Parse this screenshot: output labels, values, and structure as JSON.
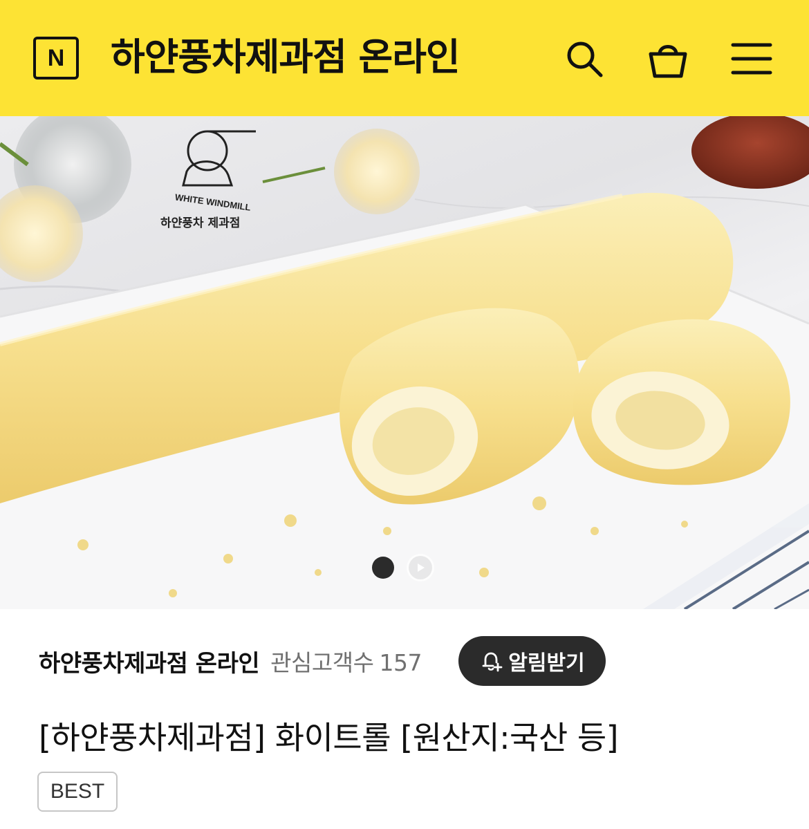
{
  "header": {
    "logo_letter": "N",
    "title": "하얀풍차제과점 온라인",
    "background_color": "#fde334",
    "icons": [
      "search-icon",
      "shopping-bag-icon",
      "menu-icon"
    ]
  },
  "hero": {
    "brand_watermark_en": "WHITE WINDMILL",
    "brand_watermark_ko": "하얀풍차 제과점",
    "carousel_current": 1,
    "carousel_total": 2
  },
  "store": {
    "name": "하얀풍차제과점 온라인",
    "followers_label": "관심고객수",
    "followers_count": "157",
    "alert_button_label": "알림받기"
  },
  "product": {
    "title": "[하얀풍차제과점] 화이트롤 [원산지:국산 등]",
    "badge": "BEST"
  }
}
